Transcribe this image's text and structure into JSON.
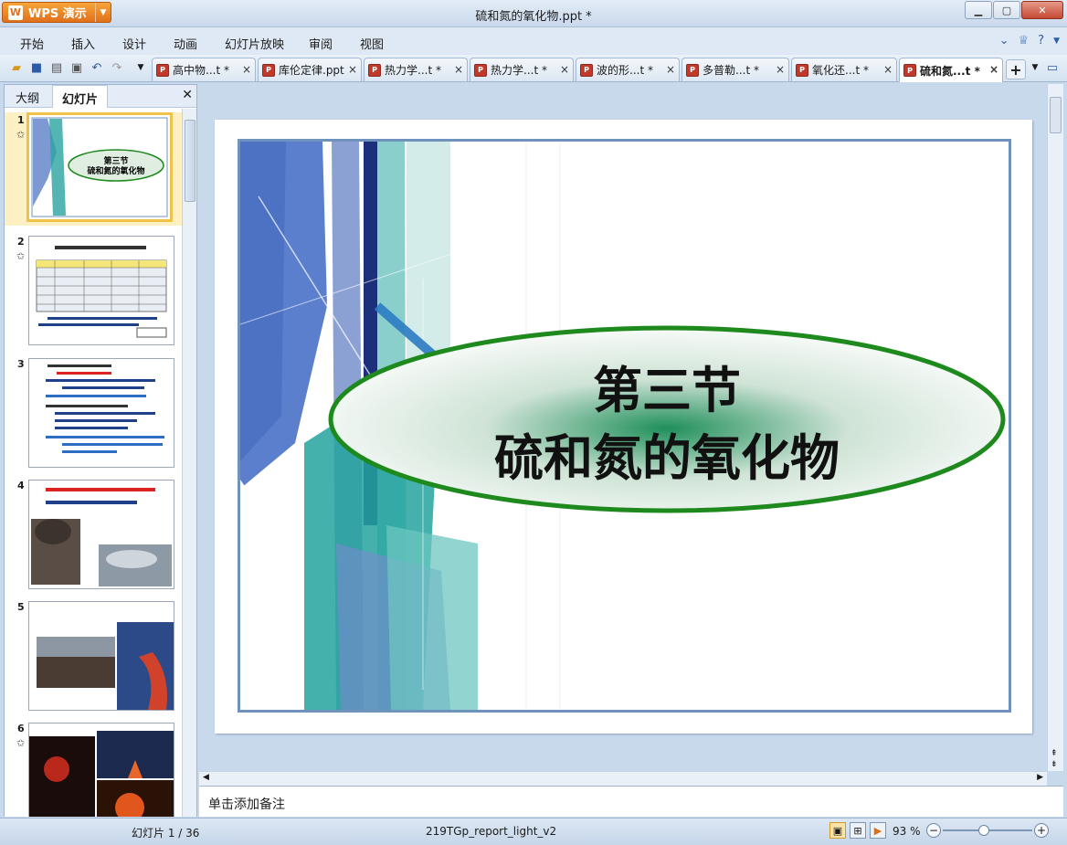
{
  "app": {
    "name": "WPS 演示",
    "document_title": "硫和氮的氧化物.ppt *"
  },
  "menu": [
    "开始",
    "插入",
    "设计",
    "动画",
    "幻灯片放映",
    "审阅",
    "视图"
  ],
  "doc_tabs": [
    "高中物...t *",
    "库伦定律.ppt",
    "热力学...t *",
    "热力学...t *",
    "波的形...t *",
    "多普勒...t *",
    "氧化还...t *",
    "硫和氮...t *"
  ],
  "active_doc_tab": 7,
  "left_panel": {
    "tabs": [
      "大纲",
      "幻灯片"
    ],
    "active_tab": 1,
    "slides": [
      {
        "number": "1",
        "has_animation": true,
        "title_line1": "第三节",
        "title_line2": "硫和氮的氧化物"
      },
      {
        "number": "2",
        "has_animation": true
      },
      {
        "number": "3",
        "has_animation": false
      },
      {
        "number": "4",
        "has_animation": true
      },
      {
        "number": "5",
        "has_animation": false
      },
      {
        "number": "6",
        "has_animation": true
      }
    ]
  },
  "slide": {
    "title_line1": "第三节",
    "title_line2": "硫和氮的氧化物"
  },
  "notes_placeholder": "单击添加备注",
  "status": {
    "slide_counter": "幻灯片 1 / 36",
    "template_name": "219TGp_report_light_v2",
    "zoom": "93 %",
    "zoom_level_percent": 93
  },
  "colors": {
    "accent": "#e0701a",
    "ellipse_border": "#1e8a1e",
    "frame_border": "#6f93bd"
  }
}
